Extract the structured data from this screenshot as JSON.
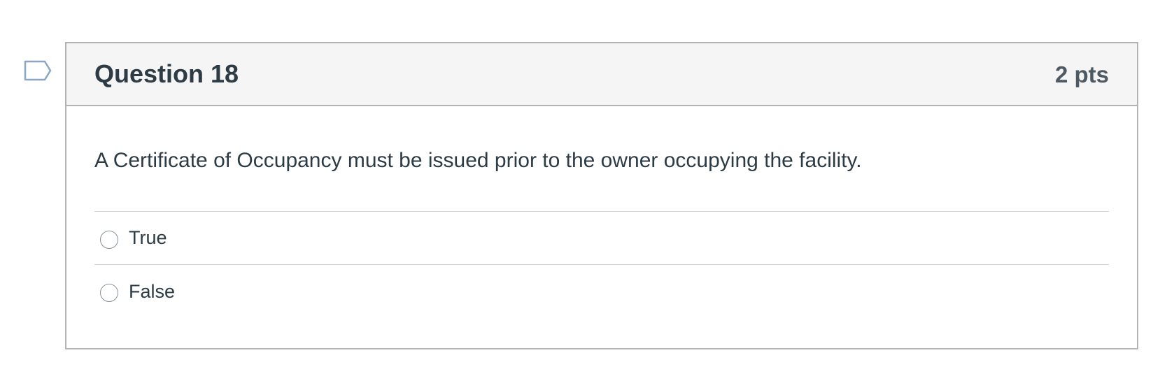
{
  "question": {
    "title": "Question 18",
    "points": "2 pts",
    "text": "A Certificate of Occupancy must be issued prior to the owner occupying the facility.",
    "flag_icon": "flag-outline-icon",
    "answers": [
      {
        "label": "True",
        "selected": false
      },
      {
        "label": "False",
        "selected": false
      }
    ]
  },
  "colors": {
    "border": "#b3b3b3",
    "header_bg": "#f5f5f5",
    "text": "#2d3b45",
    "flag": "#8aa6c1"
  }
}
